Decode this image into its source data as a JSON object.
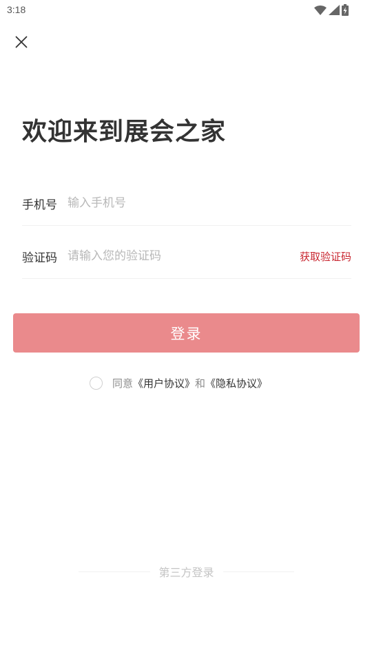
{
  "status_bar": {
    "time": "3:18",
    "icons": [
      "wifi-icon",
      "cellular-signal-icon",
      "battery-charging-icon"
    ]
  },
  "header": {
    "close_icon": "close-icon"
  },
  "welcome": {
    "title": "欢迎来到展会之家"
  },
  "form": {
    "phone": {
      "label": "手机号",
      "placeholder": "输入手机号",
      "value": ""
    },
    "code": {
      "label": "验证码",
      "placeholder": "请输入您的验证码",
      "value": "",
      "get_code_label": "获取验证码"
    }
  },
  "login": {
    "label": "登录"
  },
  "agreement": {
    "checked": false,
    "prefix": "同意",
    "user_agreement": "《用户协议》",
    "conjunction": "和",
    "privacy_policy": "《隐私协议》"
  },
  "third_party": {
    "label": "第三方登录"
  },
  "colors": {
    "accent": "#c8252f",
    "login_button": "#ea8a8c",
    "title_text": "#333333",
    "placeholder": "#b8b8b8",
    "divider": "#f1f1f1"
  }
}
